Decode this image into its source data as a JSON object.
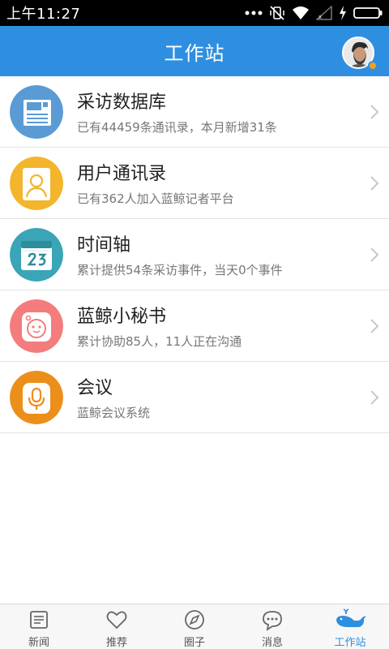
{
  "status_bar": {
    "time": "上午11:27",
    "icons": [
      "more-icon",
      "vibrate-off-icon",
      "wifi-icon",
      "signal-icon",
      "charging-icon",
      "battery-icon"
    ]
  },
  "header": {
    "title": "工作站",
    "accent": "#2e8fe0",
    "avatar_icon": "user-avatar-icon"
  },
  "list": {
    "items": [
      {
        "title": "采访数据库",
        "subtitle": "已有44459条通讯录，本月新增31条",
        "icon": "database-icon",
        "color": "#5b9bd5"
      },
      {
        "title": "用户通讯录",
        "subtitle": "已有362人加入蓝鲸记者平台",
        "icon": "contacts-icon",
        "color": "#f3b52b"
      },
      {
        "title": "时间轴",
        "subtitle": "累计提供54条采访事件，当天0个事件",
        "icon": "calendar-icon",
        "color": "#3aa5b6"
      },
      {
        "title": "蓝鲸小秘书",
        "subtitle": "累计协助85人，11人正在沟通",
        "icon": "assistant-icon",
        "color": "#f47c7c"
      },
      {
        "title": "会议",
        "subtitle": "蓝鲸会议系统",
        "icon": "microphone-icon",
        "color": "#ec8f1a"
      }
    ]
  },
  "bottom_nav": {
    "items": [
      {
        "label": "新闻",
        "icon": "news-icon"
      },
      {
        "label": "推荐",
        "icon": "heart-icon"
      },
      {
        "label": "圈子",
        "icon": "compass-icon"
      },
      {
        "label": "消息",
        "icon": "chat-icon"
      },
      {
        "label": "工作站",
        "icon": "whale-icon"
      }
    ],
    "active_index": 4
  }
}
